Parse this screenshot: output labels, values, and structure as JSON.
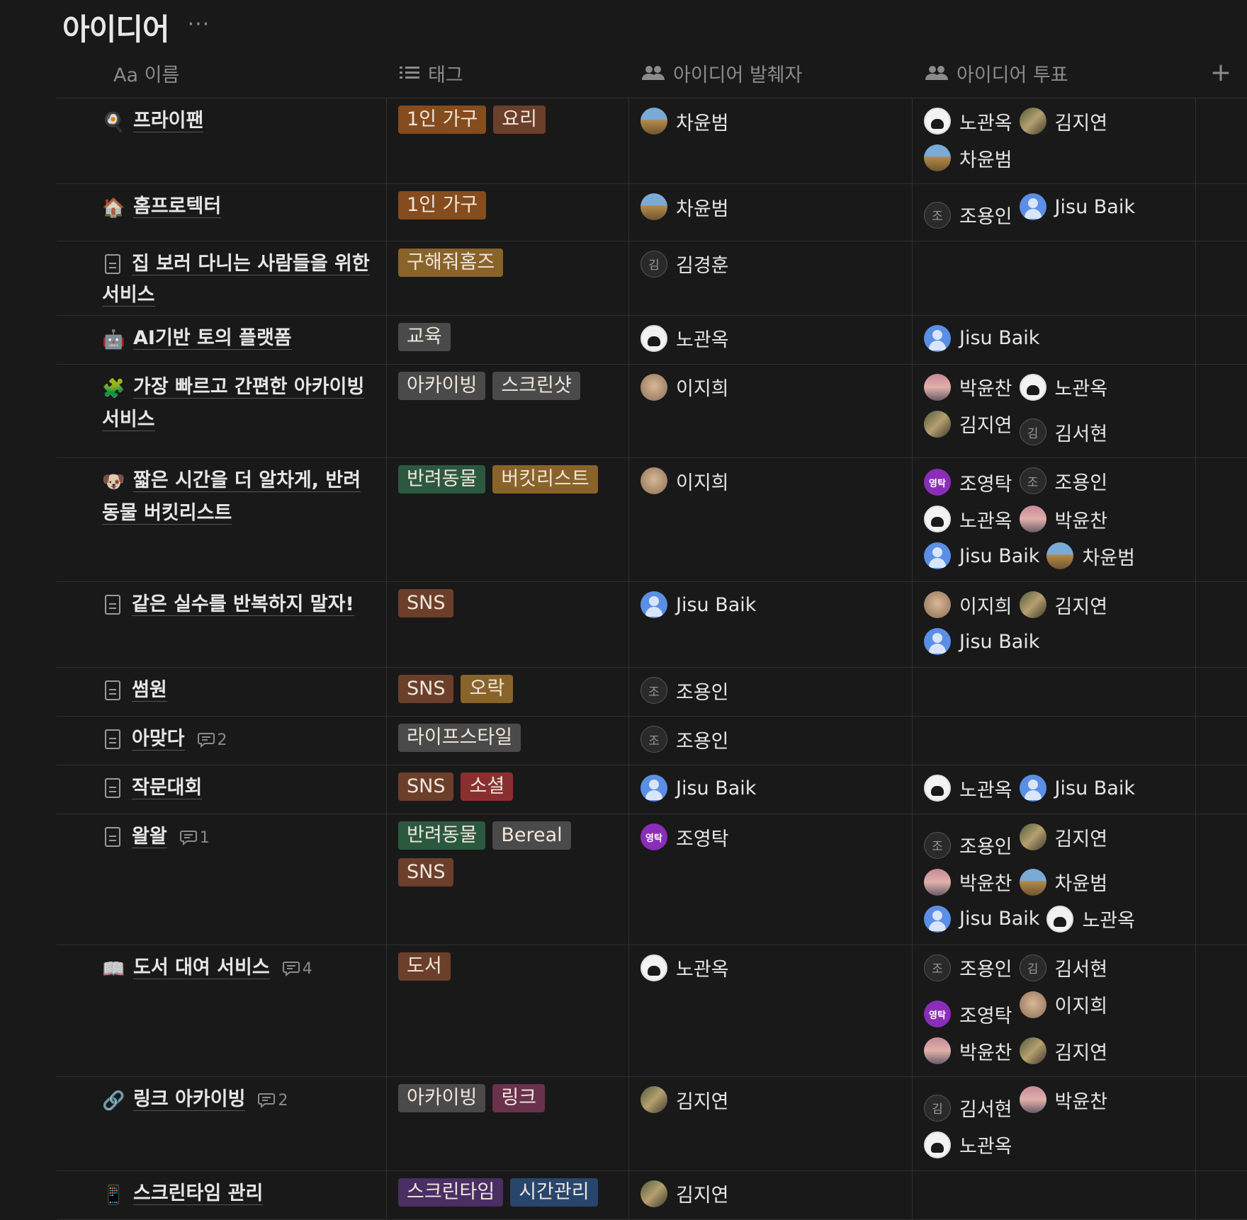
{
  "title": "아이디어",
  "more": "···",
  "headers": {
    "name": "Aa 이름",
    "tags": "태그",
    "creator": "아이디어 발췌자",
    "votes": "아이디어 투표",
    "add": "+"
  },
  "colors": {
    "orange": "#854c1d",
    "brown": "#6b3f2a",
    "yellow": "#89632a",
    "gray": "#4a4a4a",
    "green": "#2b593f",
    "red": "#8a2f2f",
    "pink": "#69314c",
    "purple": "#492f64",
    "blue": "#28456c"
  },
  "rows": [
    {
      "icon": "🍳",
      "title": "프라이팬",
      "comments": "",
      "tags": [
        {
          "label": "1인 가구",
          "color": "orange"
        },
        {
          "label": "요리",
          "color": "brown"
        }
      ],
      "creator": [
        {
          "name": "차윤범",
          "av": "cha"
        }
      ],
      "votes": [
        {
          "name": "노관옥",
          "av": "noh"
        },
        {
          "name": "김지연",
          "av": "kimj"
        },
        {
          "name": "차윤범",
          "av": "cha"
        }
      ]
    },
    {
      "icon": "🏠",
      "title": "홈프로텍터",
      "comments": "",
      "tags": [
        {
          "label": "1인 가구",
          "color": "orange"
        }
      ],
      "creator": [
        {
          "name": "차윤범",
          "av": "cha"
        }
      ],
      "votes": [
        {
          "name": "조용인",
          "av": "letter",
          "letter": "조"
        },
        {
          "name": "Jisu Baik",
          "av": "jisu"
        }
      ]
    },
    {
      "icon": "doc",
      "title": "집 보러 다니는 사람들을 위한 서비스",
      "comments": "",
      "tags": [
        {
          "label": "구해줘홈즈",
          "color": "yellow"
        }
      ],
      "creator": [
        {
          "name": "김경훈",
          "av": "letter",
          "letter": "김"
        }
      ],
      "votes": []
    },
    {
      "icon": "🤖",
      "title": "AI기반 토의 플랫폼",
      "comments": "",
      "tags": [
        {
          "label": "교육",
          "color": "gray"
        }
      ],
      "creator": [
        {
          "name": "노관옥",
          "av": "noh"
        }
      ],
      "votes": [
        {
          "name": "Jisu Baik",
          "av": "jisu"
        }
      ]
    },
    {
      "icon": "🧩",
      "title": "가장 빠르고 간편한 아카이빙 서비스",
      "comments": "",
      "tags": [
        {
          "label": "아카이빙",
          "color": "gray"
        },
        {
          "label": "스크린샷",
          "color": "gray"
        }
      ],
      "creator": [
        {
          "name": "이지희",
          "av": "lee"
        }
      ],
      "votes": [
        {
          "name": "박윤찬",
          "av": "park"
        },
        {
          "name": "노관옥",
          "av": "noh"
        },
        {
          "name": "김지연",
          "av": "kimj"
        },
        {
          "name": "김서현",
          "av": "letter",
          "letter": "김"
        }
      ]
    },
    {
      "icon": "🐶",
      "title": "짧은 시간을 더 알차게, 반려동물 버킷리스트",
      "comments": "",
      "tags": [
        {
          "label": "반려동물",
          "color": "green"
        },
        {
          "label": "버킷리스트",
          "color": "yellow"
        }
      ],
      "creator": [
        {
          "name": "이지희",
          "av": "lee"
        }
      ],
      "votes": [
        {
          "name": "조영탁",
          "av": "young",
          "letter": "영탁"
        },
        {
          "name": "조용인",
          "av": "letter",
          "letter": "조"
        },
        {
          "name": "노관옥",
          "av": "noh"
        },
        {
          "name": "박윤찬",
          "av": "park"
        },
        {
          "name": "Jisu Baik",
          "av": "jisu"
        },
        {
          "name": "차윤범",
          "av": "cha"
        }
      ]
    },
    {
      "icon": "doc",
      "title": "같은 실수를 반복하지 말자!",
      "comments": "",
      "tags": [
        {
          "label": "SNS",
          "color": "brown"
        }
      ],
      "creator": [
        {
          "name": "Jisu Baik",
          "av": "jisu"
        }
      ],
      "votes": [
        {
          "name": "이지희",
          "av": "lee"
        },
        {
          "name": "김지연",
          "av": "kimj"
        },
        {
          "name": "Jisu Baik",
          "av": "jisu"
        }
      ]
    },
    {
      "icon": "doc",
      "title": "썸원",
      "comments": "",
      "tags": [
        {
          "label": "SNS",
          "color": "brown"
        },
        {
          "label": "오락",
          "color": "yellow"
        }
      ],
      "creator": [
        {
          "name": "조용인",
          "av": "letter",
          "letter": "조"
        }
      ],
      "votes": []
    },
    {
      "icon": "doc",
      "title": "아맞다",
      "comments": "2",
      "tags": [
        {
          "label": "라이프스타일",
          "color": "gray"
        }
      ],
      "creator": [
        {
          "name": "조용인",
          "av": "letter",
          "letter": "조"
        }
      ],
      "votes": []
    },
    {
      "icon": "doc",
      "title": "작문대회",
      "comments": "",
      "tags": [
        {
          "label": "SNS",
          "color": "brown"
        },
        {
          "label": "소셜",
          "color": "red"
        }
      ],
      "creator": [
        {
          "name": "Jisu Baik",
          "av": "jisu"
        }
      ],
      "votes": [
        {
          "name": "노관옥",
          "av": "noh"
        },
        {
          "name": "Jisu Baik",
          "av": "jisu"
        }
      ]
    },
    {
      "icon": "doc",
      "title": "왈왈",
      "comments": "1",
      "tags": [
        {
          "label": "반려동물",
          "color": "green"
        },
        {
          "label": "Bereal",
          "color": "gray"
        },
        {
          "label": "SNS",
          "color": "brown"
        }
      ],
      "creator": [
        {
          "name": "조영탁",
          "av": "young",
          "letter": "영탁"
        }
      ],
      "votes": [
        {
          "name": "조용인",
          "av": "letter",
          "letter": "조"
        },
        {
          "name": "김지연",
          "av": "kimj"
        },
        {
          "name": "박윤찬",
          "av": "park"
        },
        {
          "name": "차윤범",
          "av": "cha"
        },
        {
          "name": "Jisu Baik",
          "av": "jisu"
        },
        {
          "name": "노관옥",
          "av": "noh"
        }
      ]
    },
    {
      "icon": "📖",
      "title": "도서 대여 서비스",
      "comments": "4",
      "tags": [
        {
          "label": "도서",
          "color": "brown"
        }
      ],
      "creator": [
        {
          "name": "노관옥",
          "av": "noh"
        }
      ],
      "votes": [
        {
          "name": "조용인",
          "av": "letter",
          "letter": "조"
        },
        {
          "name": "김서현",
          "av": "letter",
          "letter": "김"
        },
        {
          "name": "조영탁",
          "av": "young",
          "letter": "영탁"
        },
        {
          "name": "이지희",
          "av": "lee"
        },
        {
          "name": "박윤찬",
          "av": "park"
        },
        {
          "name": "김지연",
          "av": "kimj"
        }
      ]
    },
    {
      "icon": "🔗",
      "title": "링크 아카이빙",
      "comments": "2",
      "tags": [
        {
          "label": "아카이빙",
          "color": "gray"
        },
        {
          "label": "링크",
          "color": "pink"
        }
      ],
      "creator": [
        {
          "name": "김지연",
          "av": "kimj"
        }
      ],
      "votes": [
        {
          "name": "김서현",
          "av": "letter",
          "letter": "김"
        },
        {
          "name": "박윤찬",
          "av": "park"
        },
        {
          "name": "노관옥",
          "av": "noh"
        }
      ]
    },
    {
      "icon": "📱",
      "title": "스크린타임 관리",
      "comments": "",
      "tags": [
        {
          "label": "스크린타임",
          "color": "purple"
        },
        {
          "label": "시간관리",
          "color": "blue"
        }
      ],
      "creator": [
        {
          "name": "김지연",
          "av": "kimj"
        }
      ],
      "votes": []
    }
  ]
}
